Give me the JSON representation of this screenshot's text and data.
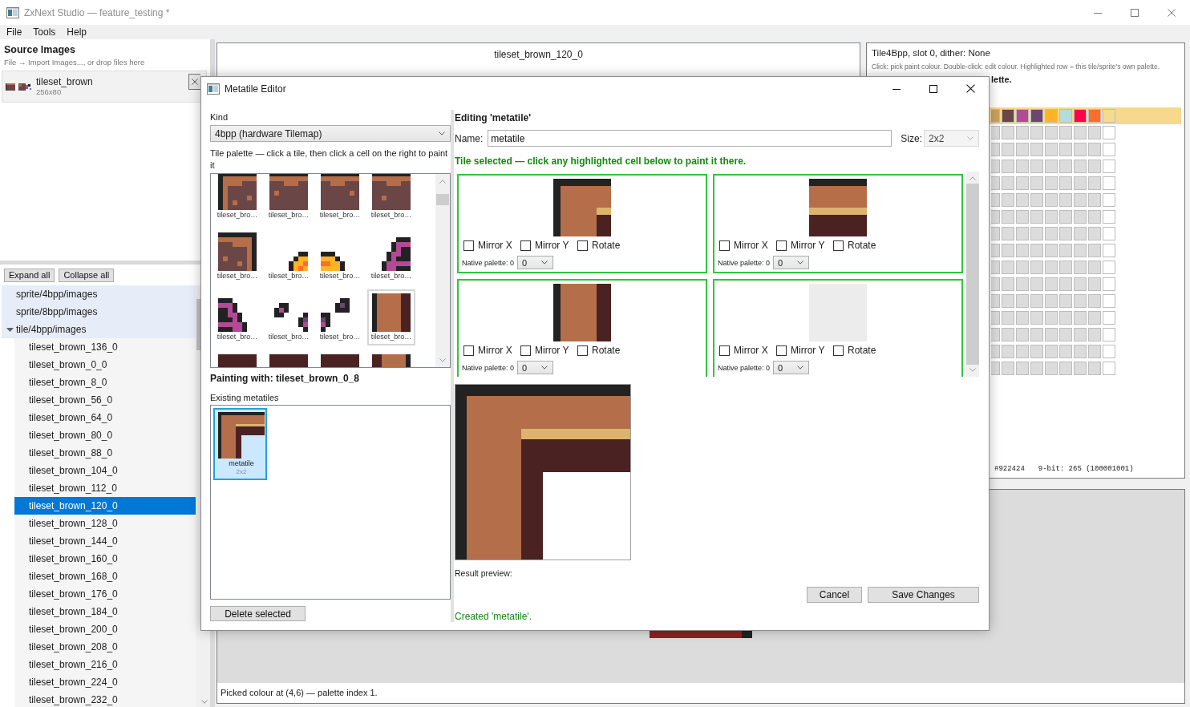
{
  "window": {
    "title": "ZxNext Studio — feature_testing *"
  },
  "menu": [
    {
      "label": "File"
    },
    {
      "label": "Tools"
    },
    {
      "label": "Help"
    }
  ],
  "source_images": {
    "title": "Source Images",
    "hint": "File → Import Images..., or drop files here",
    "items": [
      {
        "name": "tileset_brown",
        "size": "256x80"
      }
    ]
  },
  "tree": {
    "buttons": [
      "Expand all",
      "Collapse all"
    ],
    "items": [
      {
        "label": "sprite/4bpp/images",
        "selected": false
      },
      {
        "label": "sprite/8bpp/images",
        "selected": false
      },
      {
        "label": "tile/4bpp/images",
        "selected": false,
        "expanded": true,
        "children": [
          {
            "label": "tileset_brown_136_0",
            "selected": false
          },
          {
            "label": "tileset_brown_0_0",
            "selected": false
          },
          {
            "label": "tileset_brown_8_0",
            "selected": false
          },
          {
            "label": "tileset_brown_56_0",
            "selected": false
          },
          {
            "label": "tileset_brown_64_0",
            "selected": false
          },
          {
            "label": "tileset_brown_80_0",
            "selected": false
          },
          {
            "label": "tileset_brown_88_0",
            "selected": false
          },
          {
            "label": "tileset_brown_104_0",
            "selected": false
          },
          {
            "label": "tileset_brown_112_0",
            "selected": false
          },
          {
            "label": "tileset_brown_120_0",
            "selected": true
          },
          {
            "label": "tileset_brown_128_0",
            "selected": false
          },
          {
            "label": "tileset_brown_144_0",
            "selected": false
          },
          {
            "label": "tileset_brown_160_0",
            "selected": false
          },
          {
            "label": "tileset_brown_168_0",
            "selected": false
          },
          {
            "label": "tileset_brown_176_0",
            "selected": false
          },
          {
            "label": "tileset_brown_184_0",
            "selected": false
          },
          {
            "label": "tileset_brown_200_0",
            "selected": false
          },
          {
            "label": "tileset_brown_208_0",
            "selected": false
          },
          {
            "label": "tileset_brown_216_0",
            "selected": false
          },
          {
            "label": "tileset_brown_224_0",
            "selected": false
          },
          {
            "label": "tileset_brown_232_0",
            "selected": false
          }
        ]
      }
    ]
  },
  "preview": {
    "title": "tileset_brown_120_0"
  },
  "palette_panel": {
    "title": "Tile4Bpp, slot 0, dither: None",
    "hint": "Click: pick paint colour. Double-click: edit colour. Highlighted row = this tile/sprite's own palette.",
    "note": "lette.",
    "rows": [
      {
        "highlighted": true,
        "swatches": [
          {
            "color": "#c9a165"
          },
          {
            "color": "#6b4646"
          },
          {
            "color": "#b44a96"
          },
          {
            "color": "#6b4670"
          },
          {
            "color": "#ffb428"
          },
          {
            "color": "#b4dcdc"
          },
          {
            "color": "#ff0048"
          },
          {
            "color": "#ff6e28"
          },
          {
            "color": "#f5db8f"
          }
        ]
      },
      {
        "highlighted": false,
        "swatches": [
          {
            "color": "#dcdcdc"
          },
          {
            "color": "#dcdcdc"
          },
          {
            "color": "#dcdcdc"
          },
          {
            "color": "#dcdcdc"
          },
          {
            "color": "#dcdcdc"
          },
          {
            "color": "#dcdcdc"
          },
          {
            "color": "#dcdcdc"
          },
          {
            "color": "#dcdcdc"
          },
          {
            "color": "#ffffff"
          }
        ]
      },
      {
        "highlighted": false,
        "swatches": [
          {
            "color": "#dcdcdc"
          },
          {
            "color": "#dcdcdc"
          },
          {
            "color": "#dcdcdc"
          },
          {
            "color": "#dcdcdc"
          },
          {
            "color": "#dcdcdc"
          },
          {
            "color": "#dcdcdc"
          },
          {
            "color": "#dcdcdc"
          },
          {
            "color": "#dcdcdc"
          },
          {
            "color": "#ffffff"
          }
        ]
      },
      {
        "highlighted": false,
        "swatches": [
          {
            "color": "#dcdcdc"
          },
          {
            "color": "#dcdcdc"
          },
          {
            "color": "#dcdcdc"
          },
          {
            "color": "#dcdcdc"
          },
          {
            "color": "#dcdcdc"
          },
          {
            "color": "#dcdcdc"
          },
          {
            "color": "#dcdcdc"
          },
          {
            "color": "#dcdcdc"
          },
          {
            "color": "#ffffff"
          }
        ]
      },
      {
        "highlighted": false,
        "swatches": [
          {
            "color": "#dcdcdc"
          },
          {
            "color": "#dcdcdc"
          },
          {
            "color": "#dcdcdc"
          },
          {
            "color": "#dcdcdc"
          },
          {
            "color": "#dcdcdc"
          },
          {
            "color": "#dcdcdc"
          },
          {
            "color": "#dcdcdc"
          },
          {
            "color": "#dcdcdc"
          },
          {
            "color": "#ffffff"
          }
        ]
      },
      {
        "highlighted": false,
        "swatches": [
          {
            "color": "#dcdcdc"
          },
          {
            "color": "#dcdcdc"
          },
          {
            "color": "#dcdcdc"
          },
          {
            "color": "#dcdcdc"
          },
          {
            "color": "#dcdcdc"
          },
          {
            "color": "#dcdcdc"
          },
          {
            "color": "#dcdcdc"
          },
          {
            "color": "#dcdcdc"
          },
          {
            "color": "#ffffff"
          }
        ]
      },
      {
        "highlighted": false,
        "swatches": [
          {
            "color": "#dcdcdc"
          },
          {
            "color": "#dcdcdc"
          },
          {
            "color": "#dcdcdc"
          },
          {
            "color": "#dcdcdc"
          },
          {
            "color": "#dcdcdc"
          },
          {
            "color": "#dcdcdc"
          },
          {
            "color": "#dcdcdc"
          },
          {
            "color": "#dcdcdc"
          },
          {
            "color": "#ffffff"
          }
        ]
      },
      {
        "highlighted": false,
        "swatches": [
          {
            "color": "#dcdcdc"
          },
          {
            "color": "#dcdcdc"
          },
          {
            "color": "#dcdcdc"
          },
          {
            "color": "#dcdcdc"
          },
          {
            "color": "#dcdcdc"
          },
          {
            "color": "#dcdcdc"
          },
          {
            "color": "#dcdcdc"
          },
          {
            "color": "#dcdcdc"
          },
          {
            "color": "#ffffff"
          }
        ]
      },
      {
        "highlighted": false,
        "swatches": [
          {
            "color": "#dcdcdc"
          },
          {
            "color": "#dcdcdc"
          },
          {
            "color": "#dcdcdc"
          },
          {
            "color": "#dcdcdc"
          },
          {
            "color": "#dcdcdc"
          },
          {
            "color": "#dcdcdc"
          },
          {
            "color": "#dcdcdc"
          },
          {
            "color": "#dcdcdc"
          },
          {
            "color": "#ffffff"
          }
        ]
      },
      {
        "highlighted": false,
        "swatches": [
          {
            "color": "#dcdcdc"
          },
          {
            "color": "#dcdcdc"
          },
          {
            "color": "#dcdcdc"
          },
          {
            "color": "#dcdcdc"
          },
          {
            "color": "#dcdcdc"
          },
          {
            "color": "#dcdcdc"
          },
          {
            "color": "#dcdcdc"
          },
          {
            "color": "#dcdcdc"
          },
          {
            "color": "#ffffff"
          }
        ]
      },
      {
        "highlighted": false,
        "swatches": [
          {
            "color": "#dcdcdc"
          },
          {
            "color": "#dcdcdc"
          },
          {
            "color": "#dcdcdc"
          },
          {
            "color": "#dcdcdc"
          },
          {
            "color": "#dcdcdc"
          },
          {
            "color": "#dcdcdc"
          },
          {
            "color": "#dcdcdc"
          },
          {
            "color": "#dcdcdc"
          },
          {
            "color": "#ffffff"
          }
        ]
      },
      {
        "highlighted": false,
        "swatches": [
          {
            "color": "#dcdcdc"
          },
          {
            "color": "#dcdcdc"
          },
          {
            "color": "#dcdcdc"
          },
          {
            "color": "#dcdcdc"
          },
          {
            "color": "#dcdcdc"
          },
          {
            "color": "#dcdcdc"
          },
          {
            "color": "#dcdcdc"
          },
          {
            "color": "#dcdcdc"
          },
          {
            "color": "#ffffff"
          }
        ]
      },
      {
        "highlighted": false,
        "swatches": [
          {
            "color": "#dcdcdc"
          },
          {
            "color": "#dcdcdc"
          },
          {
            "color": "#dcdcdc"
          },
          {
            "color": "#dcdcdc"
          },
          {
            "color": "#dcdcdc"
          },
          {
            "color": "#dcdcdc"
          },
          {
            "color": "#dcdcdc"
          },
          {
            "color": "#dcdcdc"
          },
          {
            "color": "#ffffff"
          }
        ]
      },
      {
        "highlighted": false,
        "swatches": [
          {
            "color": "#dcdcdc"
          },
          {
            "color": "#dcdcdc"
          },
          {
            "color": "#dcdcdc"
          },
          {
            "color": "#dcdcdc"
          },
          {
            "color": "#dcdcdc"
          },
          {
            "color": "#dcdcdc"
          },
          {
            "color": "#dcdcdc"
          },
          {
            "color": "#dcdcdc"
          },
          {
            "color": "#ffffff"
          }
        ]
      },
      {
        "highlighted": false,
        "swatches": [
          {
            "color": "#dcdcdc"
          },
          {
            "color": "#dcdcdc"
          },
          {
            "color": "#dcdcdc"
          },
          {
            "color": "#dcdcdc"
          },
          {
            "color": "#dcdcdc"
          },
          {
            "color": "#dcdcdc"
          },
          {
            "color": "#dcdcdc"
          },
          {
            "color": "#dcdcdc"
          },
          {
            "color": "#ffffff"
          }
        ]
      },
      {
        "highlighted": false,
        "swatches": [
          {
            "color": "#dcdcdc"
          },
          {
            "color": "#dcdcdc"
          },
          {
            "color": "#dcdcdc"
          },
          {
            "color": "#dcdcdc"
          },
          {
            "color": "#dcdcdc"
          },
          {
            "color": "#dcdcdc"
          },
          {
            "color": "#dcdcdc"
          },
          {
            "color": "#dcdcdc"
          },
          {
            "color": "#ffffff"
          }
        ]
      }
    ],
    "hex": "#922424",
    "bits": "9-bit: 265 (100001001)"
  },
  "canvas": {
    "status": "Picked colour at (4,6) — palette index 1."
  },
  "dialog": {
    "title": "Metatile Editor",
    "kind": {
      "label": "Kind",
      "value": "4bpp (hardware Tilemap)"
    },
    "palette_hint": "Tile palette — click a tile, then click a cell on the right to paint it",
    "tiles": [
      {
        "label": "tileset_bro…",
        "selected": false
      },
      {
        "label": "tileset_bro…",
        "selected": false
      },
      {
        "label": "tileset_bro…",
        "selected": false
      },
      {
        "label": "tileset_bro…",
        "selected": false
      },
      {
        "label": "tileset_bro…",
        "selected": false
      },
      {
        "label": "tileset_bro…",
        "selected": false
      },
      {
        "label": "tileset_bro…",
        "selected": false
      },
      {
        "label": "tileset_bro…",
        "selected": false
      },
      {
        "label": "tileset_bro…",
        "selected": false
      },
      {
        "label": "tileset_bro…",
        "selected": false
      },
      {
        "label": "tileset_bro…",
        "selected": false
      },
      {
        "label": "tileset_bro…",
        "selected": true
      },
      {
        "selected": false
      },
      {
        "selected": false
      },
      {
        "selected": false
      },
      {
        "selected": false
      }
    ],
    "painting_with": "Painting with: tileset_brown_0_8",
    "existing": {
      "label": "Existing metatiles",
      "items": [
        {
          "name": "metatile",
          "size": "2x2",
          "selected": true
        }
      ]
    },
    "delete_button": "Delete selected",
    "editing_title": "Editing 'metatile'",
    "name": {
      "label": "Name:",
      "value": "metatile"
    },
    "size": {
      "label": "Size:",
      "value": "2x2",
      "disabled": true
    },
    "hint": "Tile selected — click any highlighted cell below to paint it there.",
    "cells": [
      {
        "highlighted": true,
        "empty": false,
        "options": [
          {
            "label": "Mirror X",
            "checked": false
          },
          {
            "label": "Mirror Y",
            "checked": false
          },
          {
            "label": "Rotate",
            "checked": false
          }
        ],
        "palette_label": "Native palette: 0",
        "palette_value": "0"
      },
      {
        "highlighted": true,
        "empty": false,
        "options": [
          {
            "label": "Mirror X",
            "checked": false
          },
          {
            "label": "Mirror Y",
            "checked": false
          },
          {
            "label": "Rotate",
            "checked": false
          }
        ],
        "palette_label": "Native palette: 0",
        "palette_value": "0"
      },
      {
        "highlighted": true,
        "empty": false,
        "options": [
          {
            "label": "Mirror X",
            "checked": false
          },
          {
            "label": "Mirror Y",
            "checked": false
          },
          {
            "label": "Rotate",
            "checked": false
          }
        ],
        "palette_label": "Native palette: 0",
        "palette_value": "0"
      },
      {
        "highlighted": true,
        "empty": true,
        "options": [
          {
            "label": "Mirror X",
            "checked": false
          },
          {
            "label": "Mirror Y",
            "checked": false
          },
          {
            "label": "Rotate",
            "checked": false
          }
        ],
        "palette_label": "Native palette: 0",
        "palette_value": "0"
      }
    ],
    "preview_label": "Result preview:",
    "buttons": [
      "Cancel",
      "Save Changes"
    ],
    "message": "Created 'metatile'."
  }
}
